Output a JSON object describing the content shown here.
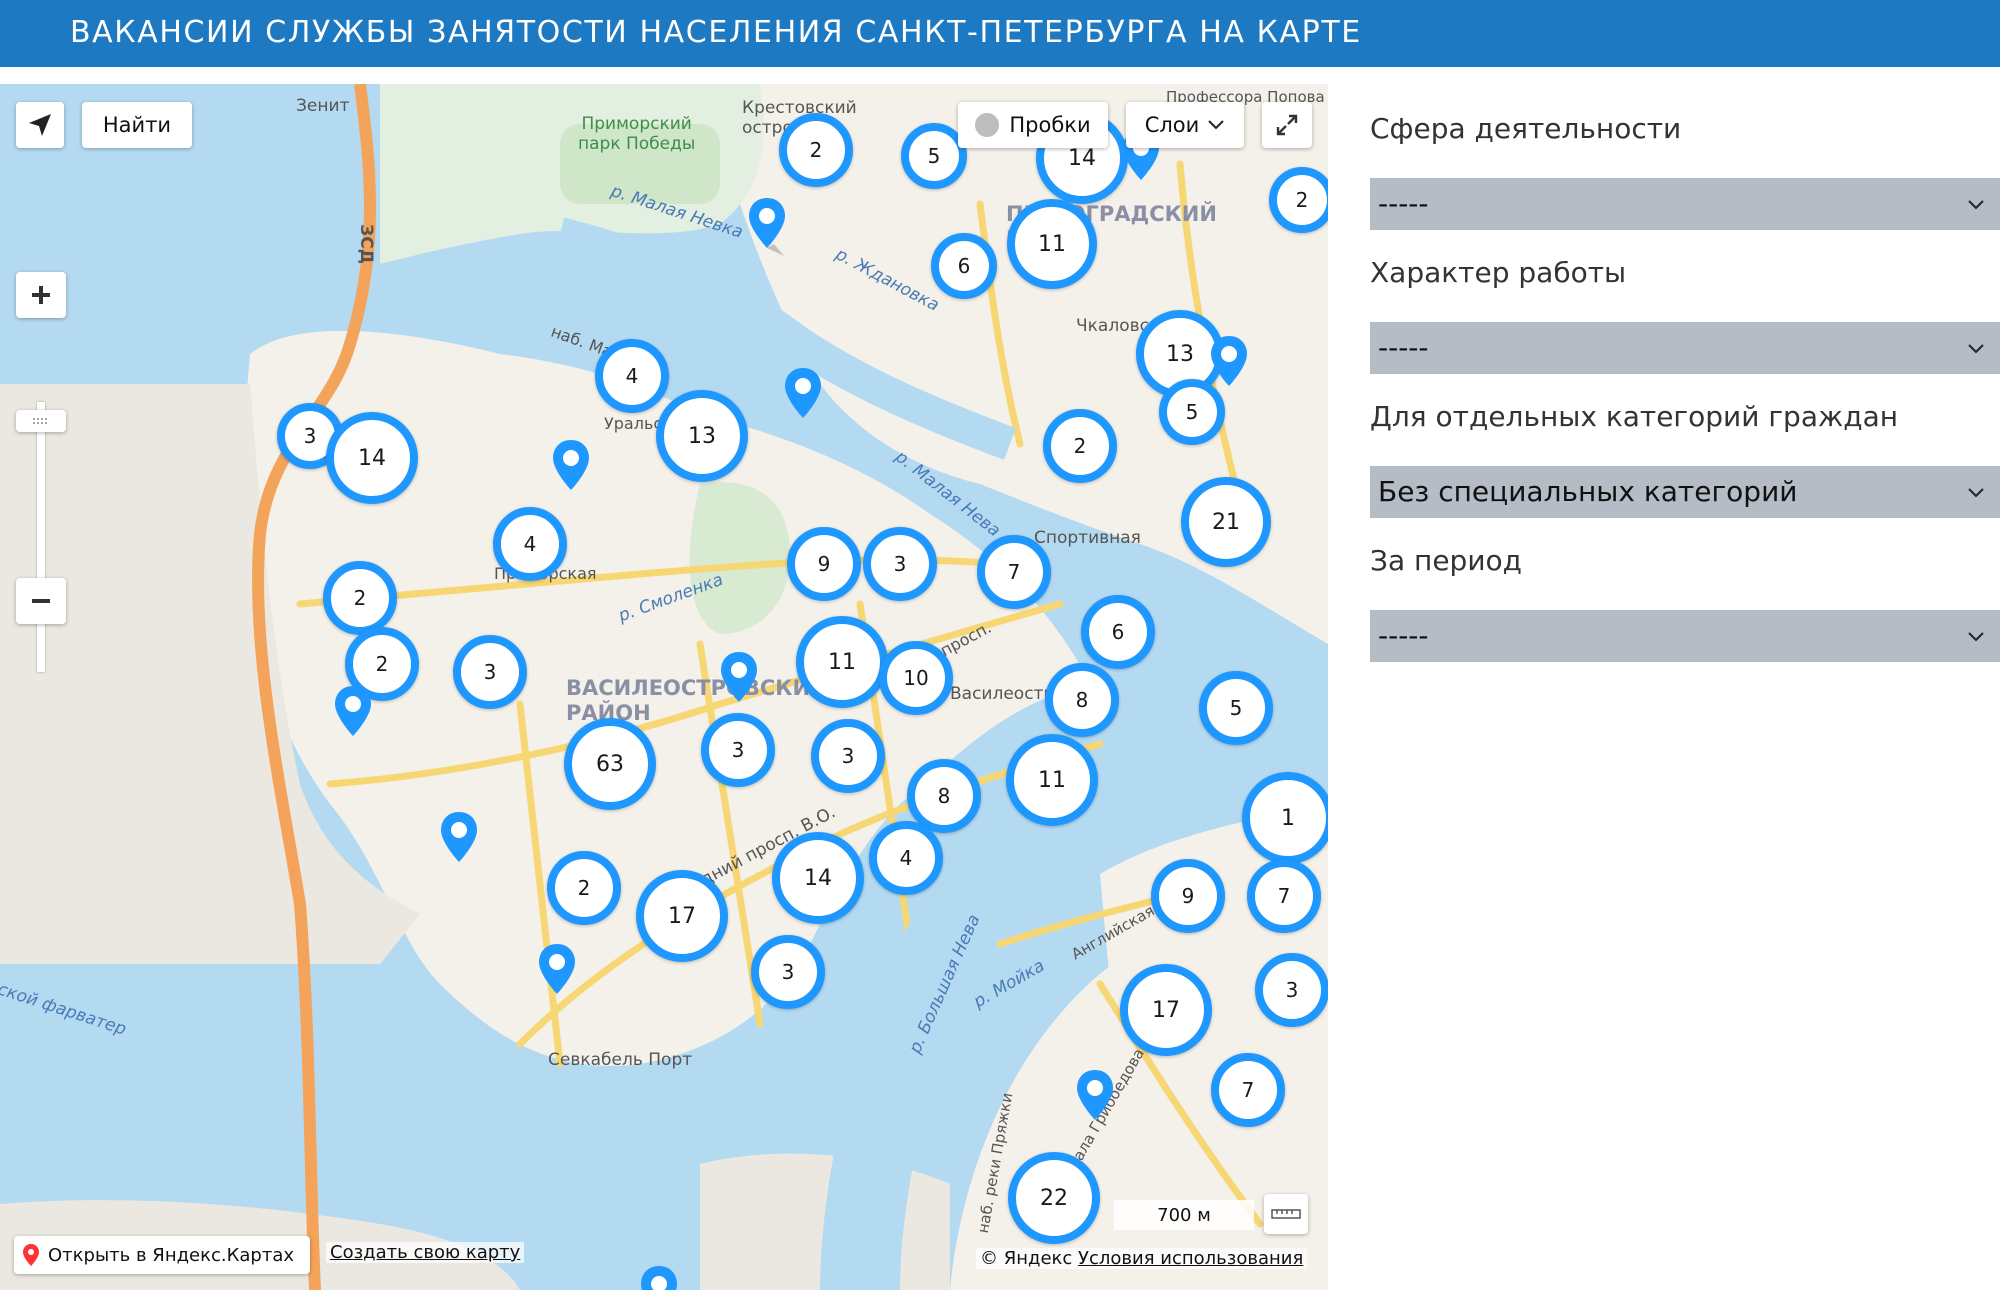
{
  "header": {
    "title": "ВАКАНСИИ СЛУЖБЫ ЗАНЯТОСТИ НАСЕЛЕНИЯ САНКТ-ПЕТЕРБУРГА НА КАРТЕ"
  },
  "map_controls": {
    "find_label": "Найти",
    "traffic_label": "Пробки",
    "layers_label": "Слои",
    "scale_label": "700 м"
  },
  "map_labels": {
    "zenit": "Зенит",
    "park": "Приморский\nпарк Победы",
    "krestovsky": "Крестовский\nостров",
    "professora": "Профессора Попова",
    "malaya_nevka": "р. Малая Невка",
    "zhdanovka": "р. Ждановка",
    "petrograd": "ПЕТРОГРАДСКИЙ\nРАЙОН",
    "chkalovskaya": "Чкаловская",
    "zsd": "ЗСД",
    "nab_makarova": "наб. Макарова",
    "uralskaya": "Уральская",
    "malaya_neva": "р. Малая Нева",
    "sportivnaya": "Спортивная",
    "primorskaya": "Приморская",
    "smolenka": "р. Смоленка",
    "vasileostrovsky": "ВАСИЛЕОСТРОВСКИЙ\nРАЙОН",
    "vasileostrovskaya": "Василеостровская",
    "sredny": "Средний просп. В.О.",
    "malyi": "Малый просп.",
    "bolshaya_neva": "р. Большая Нева",
    "angliyskaya": "Английская наб.",
    "moyka": "р. Мойка",
    "sevkabel": "Севкабель Порт",
    "farvater": "Морской фарватер",
    "griboedova": "наб. канала Грибоедова",
    "pryazhki": "наб. реки Пряжки"
  },
  "clusters": [
    {
      "label": "2"
    },
    {
      "label": "5"
    },
    {
      "label": "14"
    },
    {
      "label": "11"
    },
    {
      "label": "6"
    },
    {
      "label": "5"
    },
    {
      "label": "2"
    },
    {
      "label": "13"
    },
    {
      "label": "5"
    },
    {
      "label": "4"
    },
    {
      "label": "13"
    },
    {
      "label": "3"
    },
    {
      "label": "14"
    },
    {
      "label": "2"
    },
    {
      "label": "21"
    },
    {
      "label": "4"
    },
    {
      "label": "9"
    },
    {
      "label": "3"
    },
    {
      "label": "7"
    },
    {
      "label": "2"
    },
    {
      "label": "2"
    },
    {
      "label": "3"
    },
    {
      "label": "11"
    },
    {
      "label": "10"
    },
    {
      "label": "6"
    },
    {
      "label": "8"
    },
    {
      "label": "5"
    },
    {
      "label": "63"
    },
    {
      "label": "3"
    },
    {
      "label": "3"
    },
    {
      "label": "8"
    },
    {
      "label": "11"
    },
    {
      "label": "1"
    },
    {
      "label": "4"
    },
    {
      "label": "14"
    },
    {
      "label": "2"
    },
    {
      "label": "17"
    },
    {
      "label": "9"
    },
    {
      "label": "7"
    },
    {
      "label": "3"
    },
    {
      "label": "17"
    },
    {
      "label": "3"
    },
    {
      "label": "7"
    },
    {
      "label": "22"
    }
  ],
  "attribution": {
    "open_in_yandex": "Открыть в Яндекс.Картах",
    "create_map": "Создать свою карту",
    "copyright": "© Яндекс",
    "terms": "Условия использования"
  },
  "filters": [
    {
      "label": "Сфера деятельности",
      "value": "-----"
    },
    {
      "label": "Характер работы",
      "value": "-----"
    },
    {
      "label": "Для отдельных категорий граждан",
      "value": "Без специальных категорий"
    },
    {
      "label": "За период",
      "value": "-----"
    }
  ],
  "colors": {
    "header_bg": "#1d79c1",
    "cluster_ring": "#1e98ff",
    "select_bg": "#b5bcc6"
  }
}
